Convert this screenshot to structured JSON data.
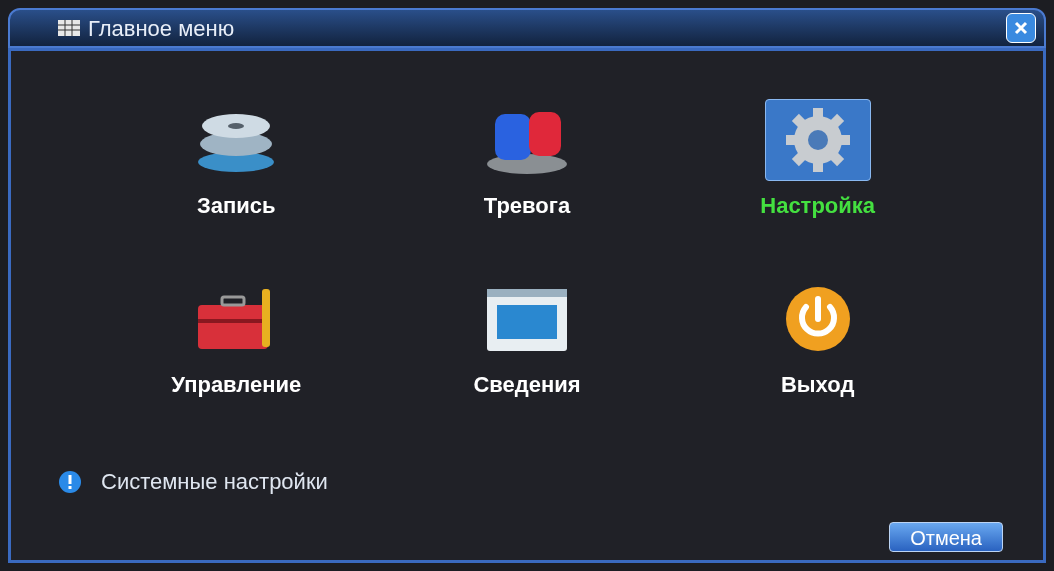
{
  "window": {
    "title": "Главное меню"
  },
  "items": [
    {
      "label": "Запись",
      "kind": "record",
      "selected": false
    },
    {
      "label": "Тревога",
      "kind": "alarm",
      "selected": false
    },
    {
      "label": "Настройка",
      "kind": "settings",
      "selected": true
    },
    {
      "label": "Управление",
      "kind": "tools",
      "selected": false
    },
    {
      "label": "Сведения",
      "kind": "info",
      "selected": false
    },
    {
      "label": "Выход",
      "kind": "power",
      "selected": false
    }
  ],
  "hint": {
    "text": "Системные настройки"
  },
  "buttons": [
    {
      "label": "Отмена"
    }
  ]
}
